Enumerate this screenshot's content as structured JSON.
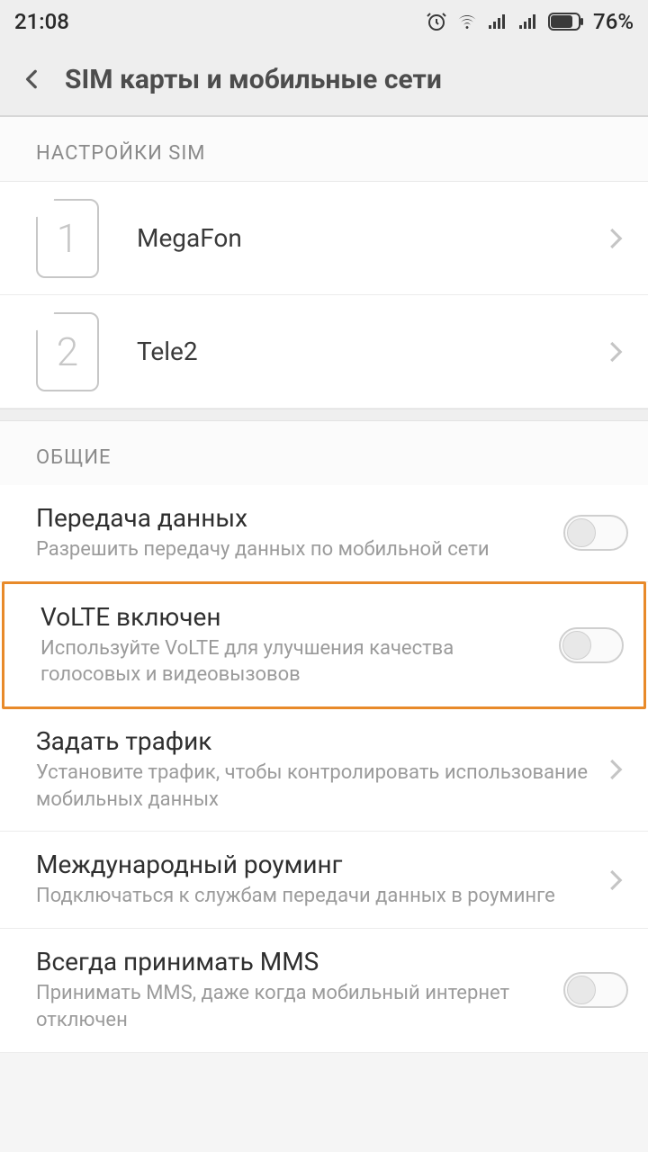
{
  "status": {
    "time": "21:08",
    "battery": "76%"
  },
  "header": {
    "title": "SIM карты и мобильные сети"
  },
  "sections": {
    "sim": {
      "header": "НАСТРОЙКИ SIM"
    },
    "general": {
      "header": "ОБЩИЕ"
    }
  },
  "sims": [
    {
      "slot": "1",
      "name": "MegaFon"
    },
    {
      "slot": "2",
      "name": "Tele2"
    }
  ],
  "settings": {
    "data": {
      "title": "Передача данных",
      "subtitle": "Разрешить передачу данных по мобильной сети",
      "toggle": false
    },
    "volte": {
      "title": "VoLTE включен",
      "subtitle": "Используйте VoLTE для улучшения качества голосовых и видеовызовов",
      "toggle": false
    },
    "traffic": {
      "title": "Задать трафик",
      "subtitle": "Установите трафик, чтобы контролировать использование мобильных данных"
    },
    "roaming": {
      "title": "Международный роуминг",
      "subtitle": "Подключаться к службам передачи данных в роуминге"
    },
    "mms": {
      "title": "Всегда принимать MMS",
      "subtitle": "Принимать MMS, даже когда мобильный интернет отключен",
      "toggle": false
    }
  }
}
